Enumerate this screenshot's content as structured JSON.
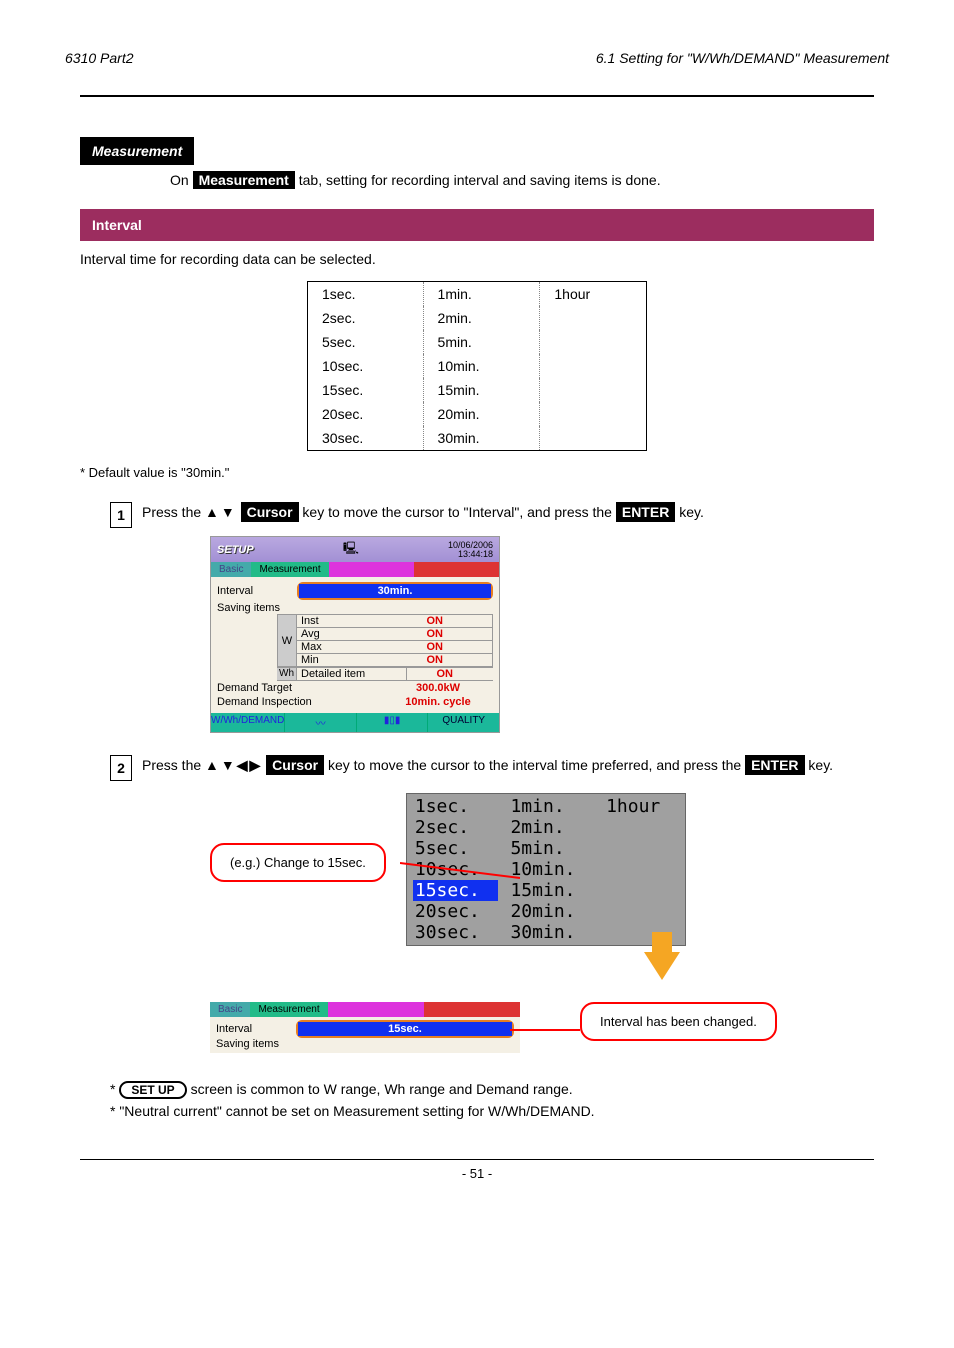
{
  "header": {
    "left": "6310 Part2",
    "right": "6.1 Setting for \"W/Wh/DEMAND\" Measurement"
  },
  "measurement": {
    "title": "Measurement",
    "desc_prefix": "On ",
    "desc_tab": "Measurement",
    "desc_suffix": " tab, setting for recording interval and saving items is done."
  },
  "interval_section": {
    "title": "Interval",
    "desc": "Interval time for recording data can be selected."
  },
  "interval_options": {
    "col1": [
      "1sec.",
      "2sec.",
      "5sec.",
      "10sec.",
      "15sec.",
      "20sec.",
      "30sec."
    ],
    "col2": [
      "1min.",
      "2min.",
      "5min.",
      "10min.",
      "15min.",
      "20min.",
      "30min."
    ],
    "col3": [
      "1hour"
    ]
  },
  "note": "* Default value is \"30min.\"",
  "step1": {
    "num": "1",
    "part1": "Press the ",
    "arrows": "▲▼",
    "cursor": "Cursor",
    "part2": " key to move the cursor to \"Interval\", and press the ",
    "enter": "ENTER",
    "part3": " key."
  },
  "device": {
    "setup": "SETUP",
    "date": "10/06/2006",
    "time": "13:44:18",
    "tab_basic": "Basic",
    "tab_meas": "Measurement",
    "interval_lbl": "Interval",
    "interval_val": "30min.",
    "saving_lbl": "Saving items",
    "w": "W",
    "rows": [
      {
        "l": "Inst",
        "v": "ON"
      },
      {
        "l": "Avg",
        "v": "ON"
      },
      {
        "l": "Max",
        "v": "ON"
      },
      {
        "l": "Min",
        "v": "ON"
      }
    ],
    "wh": "Wh",
    "wh_lbl": "Detailed item",
    "wh_val": "ON",
    "demand_target_lbl": "Demand Target",
    "demand_target_val": "300.0kW",
    "demand_insp_lbl": "Demand Inspection",
    "demand_insp_val": "10min. cycle",
    "footer": [
      "W/Wh/DEMAND",
      "〰",
      "▮▯▮",
      "QUALITY"
    ]
  },
  "step2": {
    "num": "2",
    "part1": "Press the ",
    "arrows": "▲▼◀▶",
    "cursor": "Cursor",
    "part2": " key to move the cursor to the interval time preferred, and press the",
    "enter": "ENTER",
    "part3": " key."
  },
  "callout1": "(e.g.) Change to 15sec.",
  "selected_option": "15sec.",
  "result": {
    "interval_lbl": "Interval",
    "interval_val": "15sec.",
    "saving_lbl": "Saving items"
  },
  "callout2": "Interval has been changed.",
  "footer_notes": {
    "line1_a": "* ",
    "line1_b": "SET UP",
    "line1_c": " screen is common to W range, Wh range and Demand range.",
    "line2": "* \"Neutral current\" cannot be set on Measurement setting for W/Wh/DEMAND."
  },
  "page_number": "- 51 -"
}
